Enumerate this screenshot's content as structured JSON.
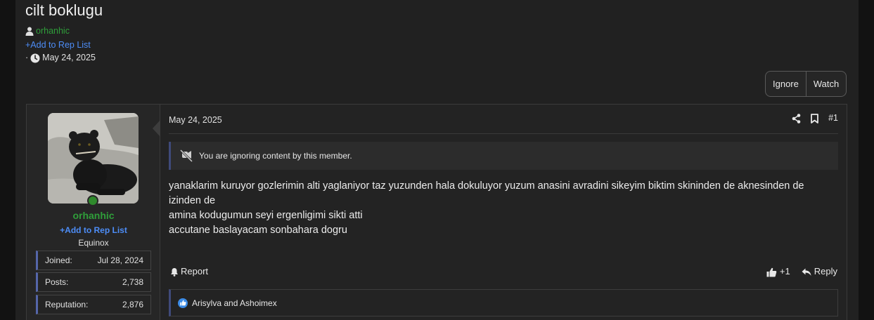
{
  "thread": {
    "title": "cilt boklugu",
    "author": "orhanhic",
    "add_rep": "+Add to Rep List",
    "date_prefix": "·",
    "date": "May 24, 2025",
    "ignore_label": "Ignore",
    "watch_label": "Watch"
  },
  "poster": {
    "username": "orhanhic",
    "add_rep": "+Add to Rep List",
    "title": "Equinox",
    "stats": [
      {
        "label": "Joined:",
        "value": "Jul 28, 2024"
      },
      {
        "label": "Posts:",
        "value": "2,738"
      },
      {
        "label": "Reputation:",
        "value": "2,876"
      }
    ],
    "online_color": "#2f8a2c"
  },
  "post": {
    "date": "May 24, 2025",
    "number": "#1",
    "ignore_notice": "You are ignoring content by this member.",
    "lines": [
      "yanaklarim kuruyor gozlerimin alti yaglaniyor taz yuzunden hala dokuluyor yuzum anasini avradini sikeyim biktim skininden de aknesinden de izinden de",
      "amina kodugumun seyi ergenligimi sikti atti",
      "accutane baslayacam sonbahara dogru"
    ],
    "report_label": "Report",
    "like_label": "+1",
    "reply_label": "Reply",
    "reactions_text": "Arisylva and Ashoimex"
  },
  "colors": {
    "username_green": "#2f9e3a",
    "link_blue": "#4d8df7",
    "accent_border": "#3f4a7a"
  },
  "icons": [
    "user-icon",
    "clock-icon",
    "share-icon",
    "bookmark-icon",
    "mute-icon",
    "bell-icon",
    "thumbs-up-icon",
    "reply-icon",
    "like-badge-icon"
  ]
}
